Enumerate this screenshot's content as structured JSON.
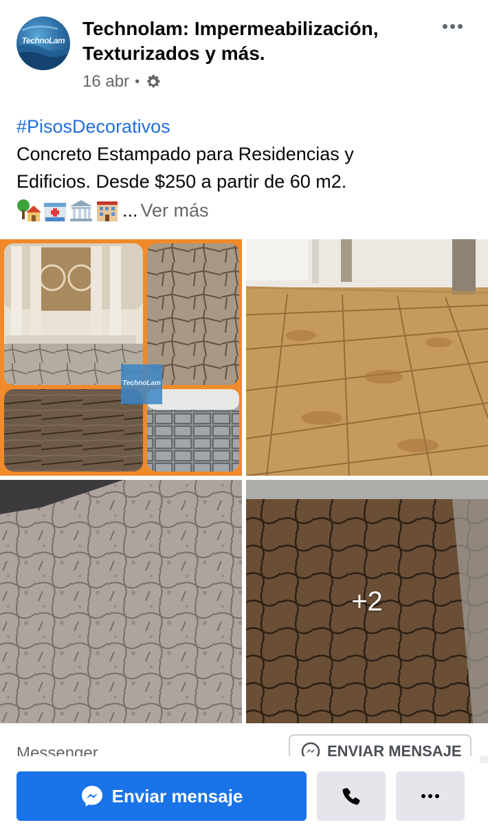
{
  "post": {
    "page_name": "Technolam: Impermeabilización, Texturizados y más.",
    "avatar_logo_text": "TechnoLam",
    "date": "16 abr",
    "meta_separator": "•",
    "privacy_icon": "gear-icon",
    "more_icon": "more-dots-icon",
    "body": {
      "hashtag": "#PisosDecorativos",
      "line1": "Concreto Estampado para Residencias y",
      "line2": "Edificios. Desde $250 a partir de 60 m2.",
      "emojis": [
        "tree-house-emoji",
        "hospital-emoji",
        "bank-emoji",
        "hotel-emoji"
      ],
      "ellipsis": "...",
      "see_more": "Ver más"
    },
    "photos": {
      "watermark": "TechnoLam",
      "more_count": "+2"
    }
  },
  "messenger": {
    "label": "Messenger",
    "small_button_label": "ENVIAR MENSAJE"
  },
  "action_bar": {
    "send_message_label": "Enviar mensaje",
    "call_icon": "phone-icon",
    "overflow_icon": "more-dots-icon"
  },
  "colors": {
    "link": "#216fdb",
    "primary_button": "#1a73e8",
    "secondary_button": "#e4e6eb",
    "muted_text": "#65676b",
    "collage_border": "#f08a2a"
  }
}
